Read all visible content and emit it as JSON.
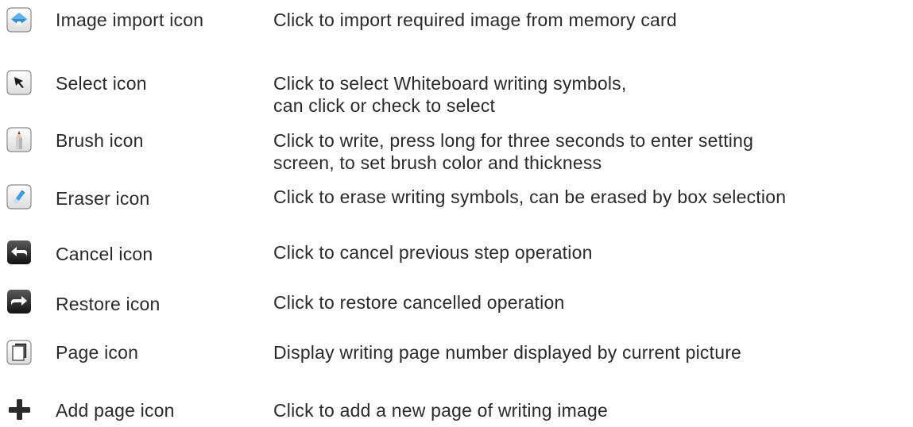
{
  "items": [
    {
      "icon": "image-import-icon",
      "name": "Image import icon",
      "description": [
        "Click to import required image from memory card"
      ]
    },
    {
      "icon": "select-arrow-icon",
      "name": "Select icon",
      "description": [
        "Click to select Whiteboard writing symbols,",
        "can click or check to select"
      ]
    },
    {
      "icon": "brush-pencil-icon",
      "name": "Brush icon",
      "description": [
        "Click to write, press long for three seconds to enter setting",
        "screen, to set brush color and thickness"
      ]
    },
    {
      "icon": "eraser-icon",
      "name": "Eraser icon",
      "description": [
        "Click to erase writing symbols, can be erased by box selection"
      ]
    },
    {
      "icon": "cancel-undo-icon",
      "name": "Cancel icon",
      "description": [
        "Click to cancel previous step operation"
      ]
    },
    {
      "icon": "restore-redo-icon",
      "name": "Restore icon",
      "description": [
        "Click to restore cancelled operation"
      ]
    },
    {
      "icon": "page-icon",
      "name": "Page icon",
      "description": [
        "Display writing page number displayed by current picture"
      ]
    },
    {
      "icon": "add-page-plus-icon",
      "name": "Add page icon",
      "description": [
        "Click to add a new page of writing image"
      ]
    }
  ],
  "colors": {
    "text": "#2a2a2a",
    "accent_blue": "#2f8fd6",
    "dark_button": "#2b2b2b"
  }
}
